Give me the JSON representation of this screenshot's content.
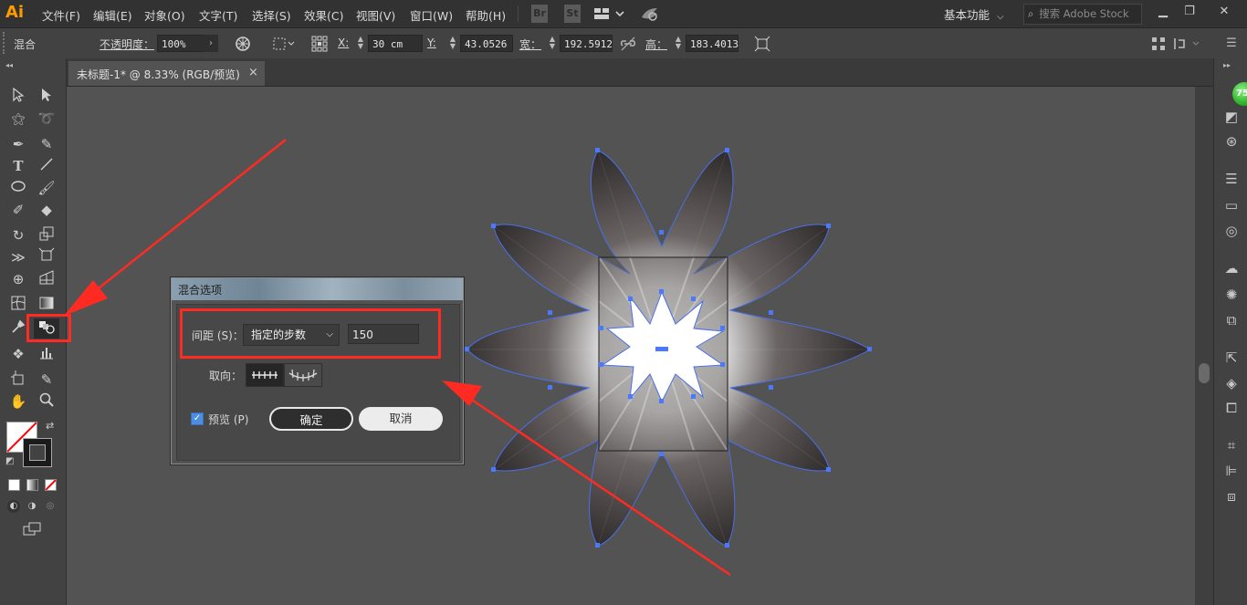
{
  "app": {
    "logo": "Ai"
  },
  "menu": [
    "文件(F)",
    "编辑(E)",
    "对象(O)",
    "文字(T)",
    "选择(S)",
    "效果(C)",
    "视图(V)",
    "窗口(W)",
    "帮助(H)"
  ],
  "menubar_icons": {
    "bridge": "Br",
    "stock": "St"
  },
  "workspace": "基本功能",
  "search": {
    "placeholder": "搜索 Adobe Stock"
  },
  "controlbar": {
    "object_type": "混合",
    "opacity_label": "不透明度：",
    "opacity_value": "100%",
    "x_label": "X:",
    "x_value": "30 cm",
    "y_label": "Y:",
    "y_value": "43.0526",
    "w_label": "宽：",
    "w_value": "192.5912",
    "h_label": "高：",
    "h_value": "183.4013"
  },
  "document": {
    "tab_title": "未标题-1* @ 8.33% (RGB/预览)",
    "close": "×"
  },
  "dialog": {
    "title": "混合选项",
    "spacing_label": "间距 (S)：",
    "spacing_value": "指定的步数",
    "steps_value": "150",
    "orientation_label": "取向：",
    "preview_label": "预览 (P)",
    "preview_checked": true,
    "ok_label": "确定",
    "cancel_label": "取消"
  },
  "right_panel": {
    "badge": "75"
  },
  "colors": {
    "accent": "#ff2b22",
    "dialog_check": "#4c8fe0",
    "anchor": "#4a78ff"
  }
}
